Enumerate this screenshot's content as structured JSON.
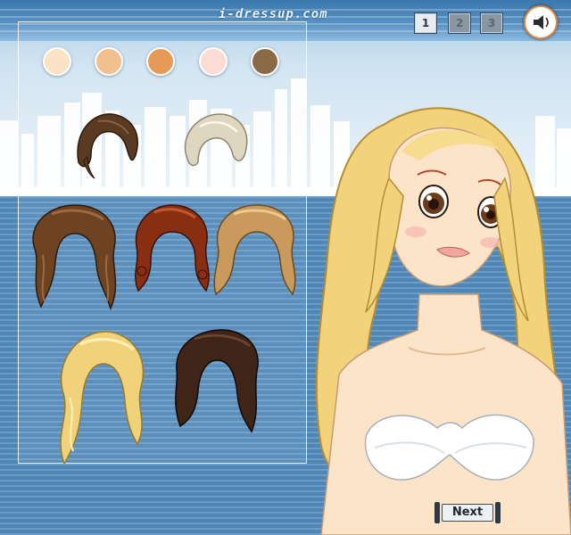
{
  "header": {
    "logo_text": "i-dressup.com",
    "pages": [
      "1",
      "2",
      "3"
    ],
    "active_page": "1"
  },
  "skin_swatches": [
    {
      "name": "skin-tone-1",
      "color": "#fbe3c6"
    },
    {
      "name": "skin-tone-2",
      "color": "#f1c08f"
    },
    {
      "name": "skin-tone-3",
      "color": "#e59a58"
    },
    {
      "name": "skin-tone-4",
      "color": "#fadcd4"
    },
    {
      "name": "skin-tone-5",
      "color": "#8a6a46"
    }
  ],
  "hairstyles": [
    {
      "name": "short-brown-updo",
      "color": "#5b3a22"
    },
    {
      "name": "short-platinum-pixie",
      "color": "#ded6be"
    },
    {
      "name": "long-brown-wavy",
      "color": "#6e4322"
    },
    {
      "name": "curly-auburn",
      "color": "#8a2e12"
    },
    {
      "name": "long-honey-blonde",
      "color": "#c99a5c"
    },
    {
      "name": "long-golden-curls",
      "color": "#f0d27a"
    },
    {
      "name": "dark-brown-bob",
      "color": "#3f2418"
    }
  ],
  "model": {
    "hair_color": "#f2d27a",
    "skin_color": "#fbe4c8",
    "eye_color": "#6b3c1c",
    "top": "white strapless bra"
  },
  "buttons": {
    "next_label": "Next"
  },
  "colors": {
    "background_stripe": "#4f86b6",
    "sky": "#cfe3f1",
    "sound_ring": "#e08a4a"
  }
}
